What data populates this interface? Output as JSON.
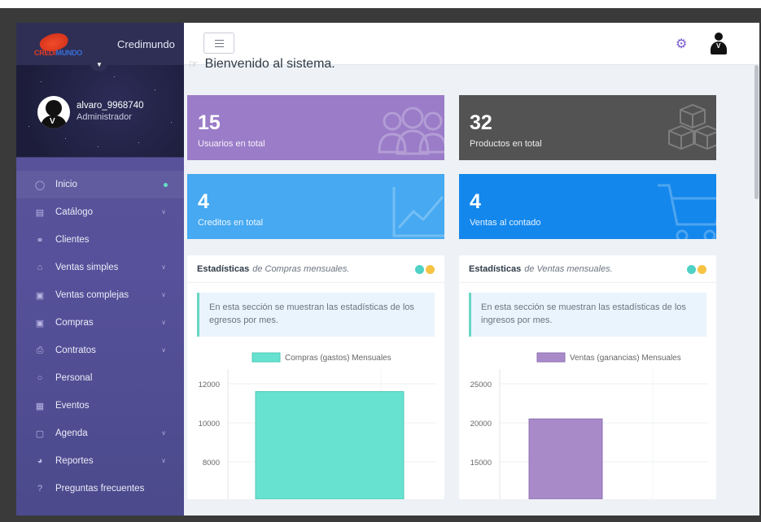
{
  "brand": {
    "logo_text_red": "CREDI",
    "logo_text_blue": "MUNDO",
    "name": "Credimundo"
  },
  "user": {
    "username": "alvaro_9968740",
    "role": "Administrador"
  },
  "menu": [
    {
      "label": "Inicio",
      "icon": "home-icon",
      "active": true
    },
    {
      "label": "Catálogo",
      "icon": "catalog-icon",
      "chevron": true
    },
    {
      "label": "Clientes",
      "icon": "clients-icon"
    },
    {
      "label": "Ventas simples",
      "icon": "store-icon",
      "chevron": true
    },
    {
      "label": "Ventas complejas",
      "icon": "cart-icon",
      "chevron": true
    },
    {
      "label": "Compras",
      "icon": "cart-icon",
      "chevron": true
    },
    {
      "label": "Contratos",
      "icon": "printer-icon",
      "chevron": true
    },
    {
      "label": "Personal",
      "icon": "person-icon"
    },
    {
      "label": "Eventos",
      "icon": "calendar-icon"
    },
    {
      "label": "Agenda",
      "icon": "calendar-icon",
      "chevron": true
    },
    {
      "label": "Reportes",
      "icon": "chart-icon",
      "chevron": true
    },
    {
      "label": "Preguntas frecuentes",
      "icon": "question-icon"
    }
  ],
  "welcome": "Bienvenido al sistema.",
  "tiles": {
    "users": {
      "value": "15",
      "label": "Usuarios en total"
    },
    "products": {
      "value": "32",
      "label": "Productos en total"
    },
    "credits": {
      "value": "4",
      "label": "Creditos en total"
    },
    "sales": {
      "value": "4",
      "label": "Ventas al contado"
    }
  },
  "cards": {
    "compras": {
      "title_bold": "Estadísticas",
      "title_italic": "de Compras mensuales.",
      "note": "En esta sección se muestran las estadísticas de los egresos por mes."
    },
    "ventas": {
      "title_bold": "Estadísticas",
      "title_italic": "de Ventas mensuales.",
      "note": "En esta sección se muestran las estadísticas de los ingresos por mes."
    }
  },
  "colors": {
    "teal": "#4fd1c5",
    "yellow": "#f6c343",
    "compras_bar": "#67e2d0",
    "ventas_bar": "#a98ac9"
  },
  "chart_data": [
    {
      "type": "bar",
      "legend": "Compras (gastos) Mensuales",
      "yticks": [
        8000,
        10000,
        12000
      ],
      "visible_ylim": [
        7000,
        12300
      ],
      "values": [
        11600
      ]
    },
    {
      "type": "bar",
      "legend": "Ventas (ganancias) Mensuales",
      "yticks": [
        15000,
        20000,
        25000
      ],
      "visible_ylim": [
        12000,
        25500
      ],
      "values": [
        20500
      ]
    }
  ]
}
